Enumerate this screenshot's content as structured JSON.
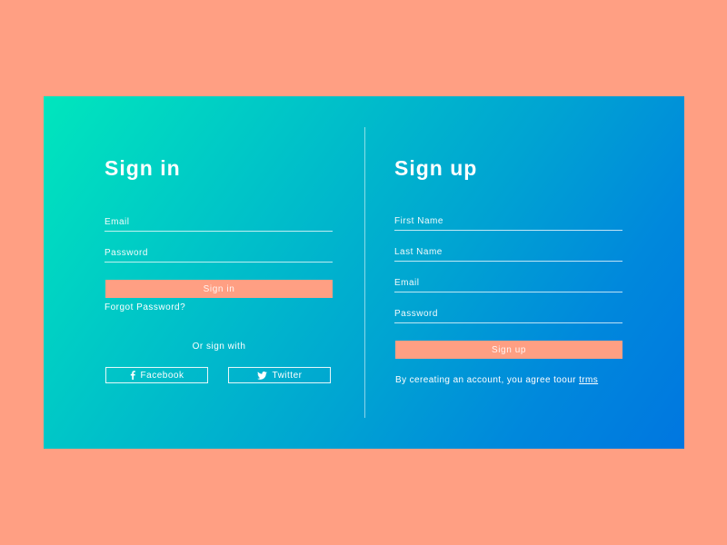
{
  "colors": {
    "background": "#ff9f83",
    "gradient_start": "#00e6bd",
    "gradient_end": "#0076e0",
    "button": "#ff9f83",
    "text": "#ffffff"
  },
  "signin": {
    "title": "Sign in",
    "email_placeholder": "Email",
    "password_placeholder": "Password",
    "submit_label": "Sign in",
    "forgot_label": "Forgot Password?",
    "or_label": "Or sign with",
    "social": [
      {
        "label": "Facebook",
        "icon": "facebook-icon"
      },
      {
        "label": "Twitter",
        "icon": "twitter-icon"
      }
    ]
  },
  "signup": {
    "title": "Sign up",
    "first_name_placeholder": "First Name",
    "last_name_placeholder": "Last Name",
    "email_placeholder": "Email",
    "password_placeholder": "Password",
    "submit_label": "Sign up",
    "terms_prefix": "By cereating an account, you agree toour ",
    "terms_link": "trms"
  }
}
